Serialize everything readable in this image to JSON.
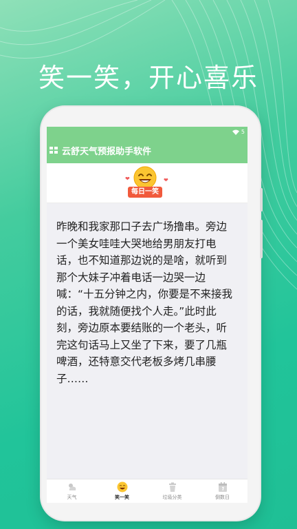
{
  "headline": "笑一笑，开心喜乐",
  "status_bar": {
    "battery": "5"
  },
  "app_bar": {
    "title": "云舒天气预报助手软件"
  },
  "badge": {
    "label": "每日一笑"
  },
  "joke": {
    "text": "昨晚和我家那口子去广场撸串。旁边一个美女哇哇大哭地给男朋友打电话，也不知道那边说的是啥，就听到那个大妹子冲着电话一边哭一边喊：“十五分钟之内，你要是不来接我的话，我就随便找个人走。”此时此刻，旁边原本要结账的一个老头，听完这句话马上又坐了下来，要了几瓶啤酒，还特意交代老板多烤几串腰子……"
  },
  "tabs": [
    {
      "label": "天气",
      "icon": "weather-icon",
      "active": false
    },
    {
      "label": "笑一笑",
      "icon": "smile-icon",
      "active": true
    },
    {
      "label": "垃圾分类",
      "icon": "trash-icon",
      "active": false
    },
    {
      "label": "倒数日",
      "icon": "calendar-icon",
      "active": false
    }
  ],
  "colors": {
    "app_bar": "#7ed28c",
    "badge": "#f15a3c",
    "background": "#21c49a"
  }
}
